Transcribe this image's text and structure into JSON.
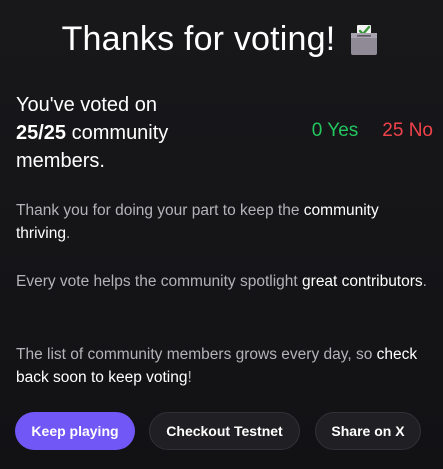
{
  "title": "Thanks for voting!",
  "icons": {
    "title_icon": "ballot-box-icon"
  },
  "summary": {
    "line1": "You've voted on",
    "count": "25/25",
    "line2": " community",
    "line3": "members."
  },
  "tally": {
    "yes": "0 Yes",
    "no": "25 No"
  },
  "paragraphs": {
    "p1_a": "Thank you for doing your part to keep the ",
    "p1_b": "community thriving",
    "p1_c": ".",
    "p2_a": "Every vote helps the community spotlight ",
    "p2_b": "great contributors",
    "p2_c": ".",
    "p3_a": "The list of community members grows every day, so ",
    "p3_b": "check back soon to keep voting",
    "p3_c": "!"
  },
  "buttons": {
    "keep_playing": "Keep playing",
    "checkout_testnet": "Checkout Testnet",
    "share": "Share on X"
  },
  "colors": {
    "yes": "#22c55e",
    "no": "#f0424a",
    "primary": "#7257f7",
    "background": "#17171a"
  }
}
